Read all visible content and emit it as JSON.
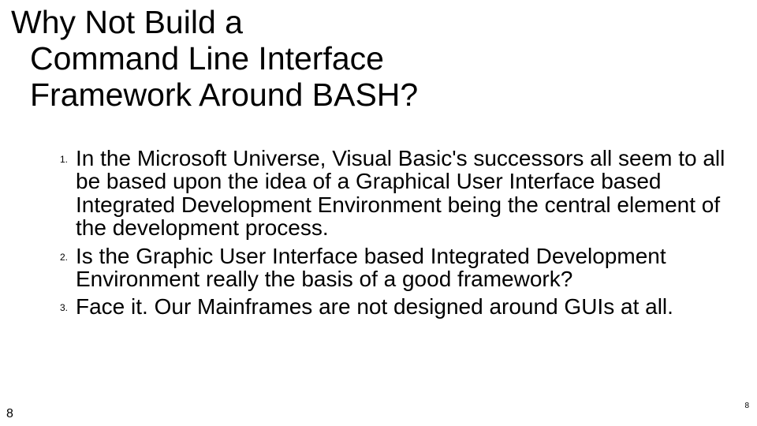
{
  "slide": {
    "title_line1": "Why Not Build a",
    "title_line2": "Command Line Interface",
    "title_line3": "Framework Around BASH?",
    "points": [
      "In the Microsoft Universe, Visual Basic's successors all seem to all be based upon the idea of a Graphical User Interface based Integrated Development Environment being the central element of the development process.",
      "Is the Graphic User Interface based Integrated Development Environment really the basis of a good framework?",
      "Face it.  Our Mainframes are not designed around GUIs at all."
    ],
    "page_number_left": "8",
    "page_number_right": "8"
  }
}
